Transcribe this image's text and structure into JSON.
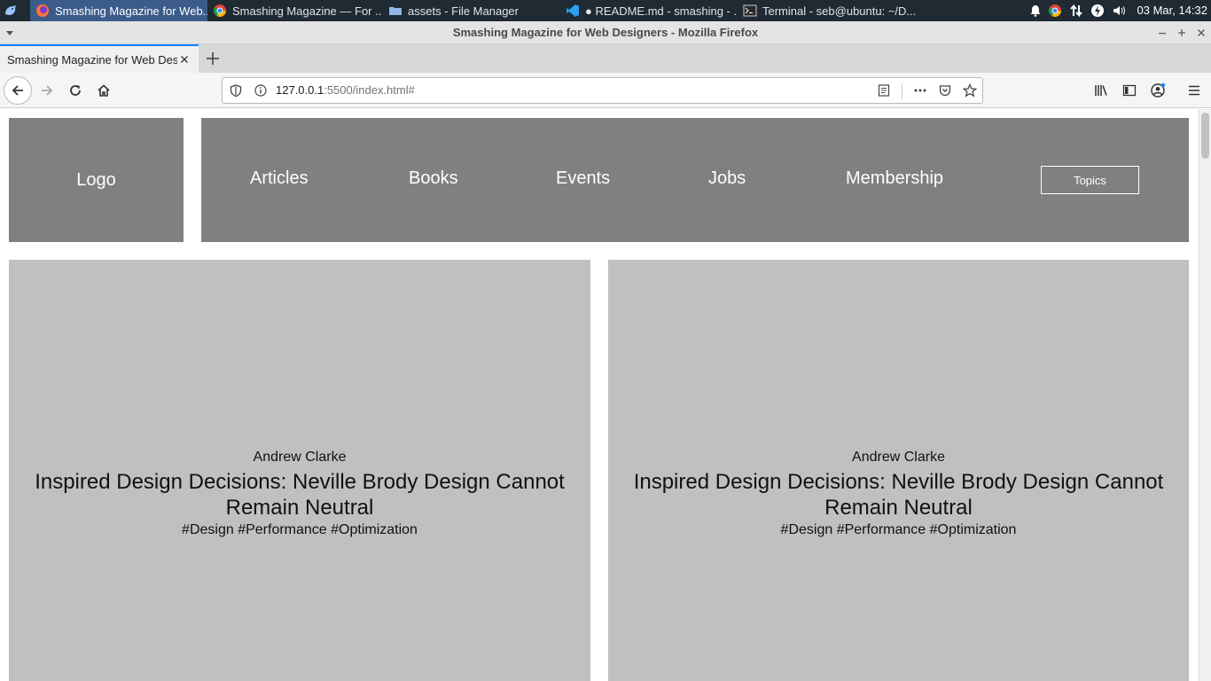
{
  "taskbar": {
    "tasks": [
      {
        "label": "Smashing Magazine for Web...",
        "icon": "firefox-icon"
      },
      {
        "label": "Smashing Magazine — For ...",
        "icon": "chrome-icon"
      },
      {
        "label": "assets - File Manager",
        "icon": "folder-icon"
      },
      {
        "label": "● README.md - smashing - ...",
        "icon": "vscode-icon"
      },
      {
        "label": "Terminal - seb@ubuntu: ~/D...",
        "icon": "terminal-icon"
      }
    ],
    "clock": "03 Mar, 14:32"
  },
  "window": {
    "title": "Smashing Magazine for Web Designers - Mozilla Firefox"
  },
  "browser": {
    "tab_title": "Smashing Magazine for Web Designers",
    "url_host": "127.0.0.1",
    "url_rest": ":5500/index.html#"
  },
  "page": {
    "logo": "Logo",
    "nav": [
      "Articles",
      "Books",
      "Events",
      "Jobs",
      "Membership"
    ],
    "topics_button": "Topics",
    "cards": [
      {
        "author": "Andrew Clarke",
        "title": "Inspired Design Decisions: Neville Brody Design Cannot Remain Neutral",
        "tags": "#Design #Performance #Optimization"
      },
      {
        "author": "Andrew Clarke",
        "title": "Inspired Design Decisions: Neville Brody Design Cannot Remain Neutral",
        "tags": "#Design #Performance #Optimization"
      }
    ]
  },
  "colors": {
    "header_gray": "#808080",
    "card_gray": "#c0c0c0",
    "taskbar_bg": "#1f2a33",
    "accent_blue": "#0a84ff"
  }
}
